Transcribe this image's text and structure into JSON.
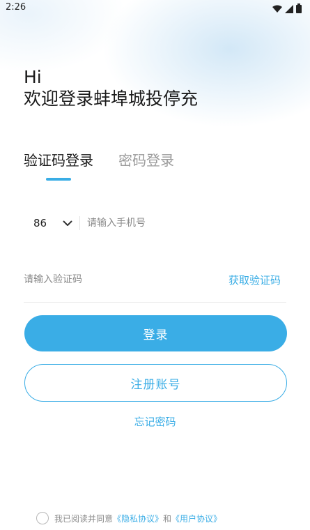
{
  "status_bar": {
    "time": "2:26",
    "icons": [
      "wifi-icon",
      "signal-icon",
      "battery-icon"
    ]
  },
  "greeting": {
    "line1": "Hi",
    "line2": "欢迎登录蚌埠城投停充"
  },
  "tabs": [
    {
      "label": "验证码登录",
      "active": true
    },
    {
      "label": "密码登录",
      "active": false
    }
  ],
  "phone": {
    "country_code": "86",
    "placeholder": "请输入手机号",
    "value": ""
  },
  "verification": {
    "placeholder": "请输入验证码",
    "value": "",
    "get_code_label": "获取验证码"
  },
  "buttons": {
    "login_label": "登录",
    "register_label": "注册账号",
    "forgot_label": "忘记密码"
  },
  "agreement": {
    "prefix": "我已阅读并同意",
    "privacy_link": "《隐私协议》",
    "conjunction": "和",
    "user_link": "《用户协议》",
    "checked": false
  },
  "colors": {
    "accent": "#3aade6",
    "text_primary": "#1a1a1a",
    "text_muted": "#9a9a9a"
  }
}
